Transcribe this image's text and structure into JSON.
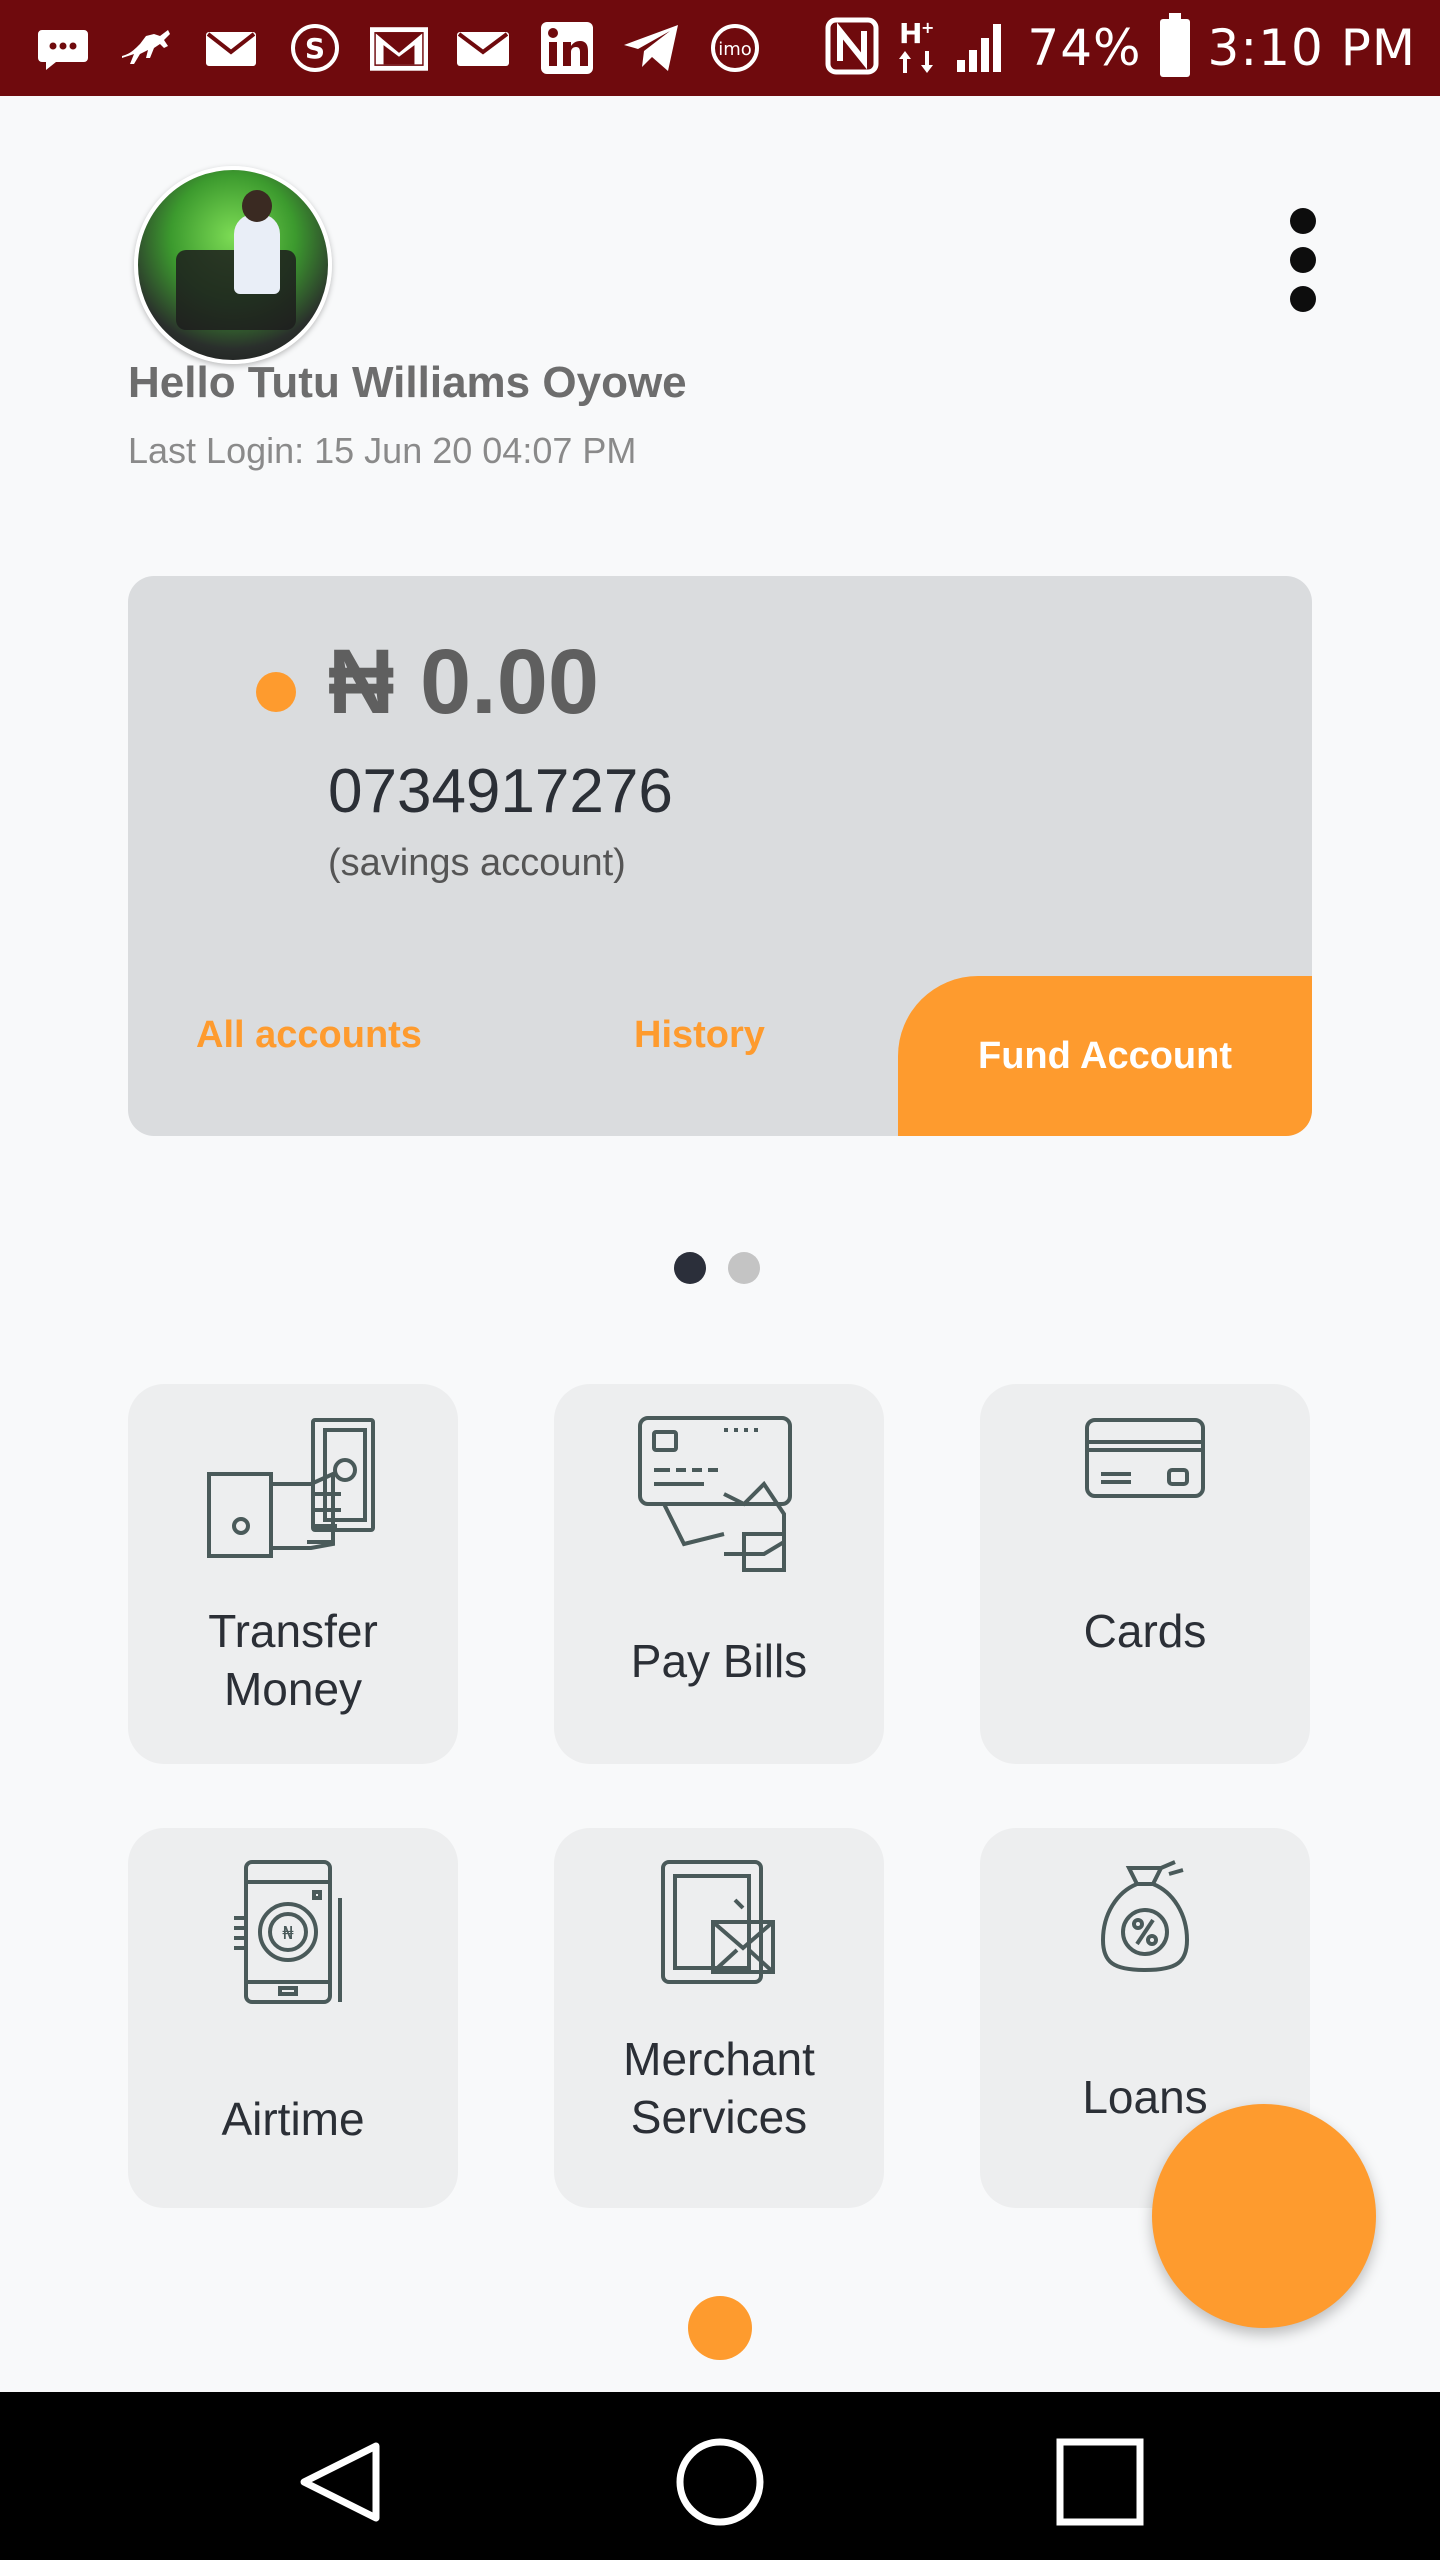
{
  "status_bar": {
    "battery": "74%",
    "time": "3:10 PM",
    "notification_icons": [
      "message-icon",
      "horse-icon",
      "mail-icon",
      "skype-icon",
      "gmail-icon",
      "mail-icon",
      "linkedin-icon",
      "telegram-icon",
      "imo-icon"
    ],
    "status_icons": [
      "nfc-icon",
      "hplus-data-icon",
      "signal-icon",
      "battery-icon"
    ]
  },
  "profile": {
    "greeting": "Hello Tutu Williams Oyowe",
    "last_login": "Last Login:  15 Jun 20 04:07 PM"
  },
  "account_card": {
    "balance": "₦ 0.00",
    "account_number": "0734917276",
    "account_type": "(savings account)",
    "all_accounts_label": "All accounts",
    "history_label": "History",
    "fund_label": "Fund Account",
    "accent_color": "#fe9b2e"
  },
  "pager": {
    "active_index": 0,
    "count": 2
  },
  "services": [
    {
      "label_line1": "Transfer",
      "label_line2": "Money",
      "icon": "hand-money-icon"
    },
    {
      "label_line1": "Pay Bills",
      "label_line2": "",
      "icon": "card-payment-icon"
    },
    {
      "label_line1": "Cards",
      "label_line2": "",
      "icon": "credit-card-icon"
    },
    {
      "label_line1": "Airtime",
      "label_line2": "",
      "icon": "phone-naira-icon"
    },
    {
      "label_line1": "Merchant",
      "label_line2": "Services",
      "icon": "tablet-mail-icon"
    },
    {
      "label_line1": "Loans",
      "label_line2": "",
      "icon": "money-bag-icon"
    }
  ],
  "nav": {
    "buttons": [
      "back-icon",
      "home-icon",
      "recents-icon"
    ]
  }
}
